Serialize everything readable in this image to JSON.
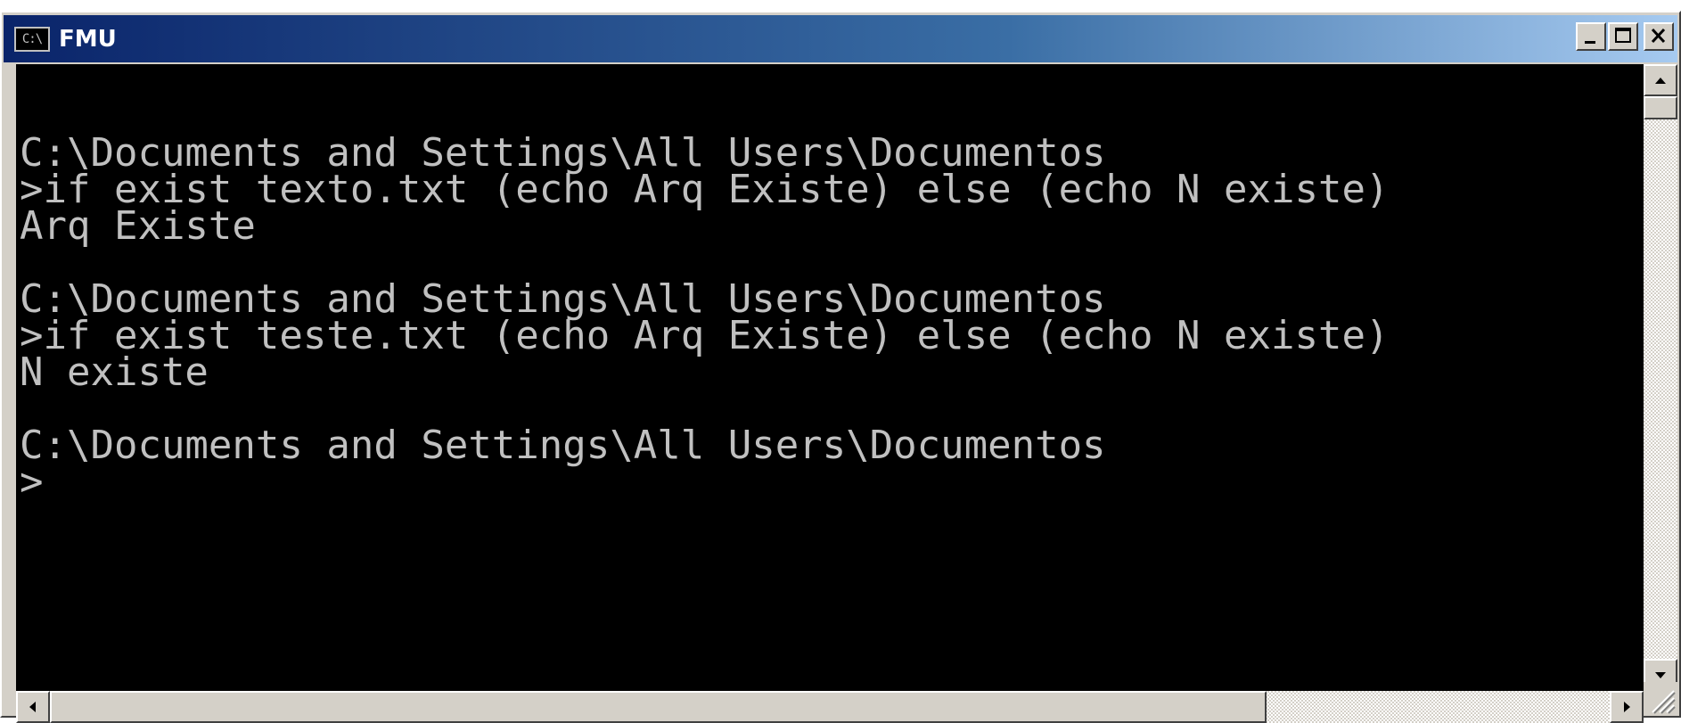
{
  "window": {
    "title": "FMU",
    "icon": "console-icon",
    "icon_glyph": "C:\\"
  },
  "title_buttons": {
    "minimize_icon": "minimize-icon",
    "maximize_icon": "maximize-icon",
    "close_icon": "close-icon"
  },
  "console": {
    "background": "#000000",
    "foreground": "#c0c0c0",
    "lines": [
      "",
      "C:\\Documents and Settings\\All Users\\Documentos",
      ">if exist texto.txt (echo Arq Existe) else (echo N existe)",
      "Arq Existe",
      "",
      "C:\\Documents and Settings\\All Users\\Documentos",
      ">if exist teste.txt (echo Arq Existe) else (echo N existe)",
      "N existe",
      "",
      "C:\\Documents and Settings\\All Users\\Documentos",
      ">"
    ]
  },
  "scrollbars": {
    "vertical_thumb_fraction": 0.04,
    "horizontal_thumb_fraction": 0.78
  },
  "colors": {
    "titlebar_start": "#0a246a",
    "titlebar_end": "#a6caf0",
    "chrome": "#d4d0c8"
  }
}
